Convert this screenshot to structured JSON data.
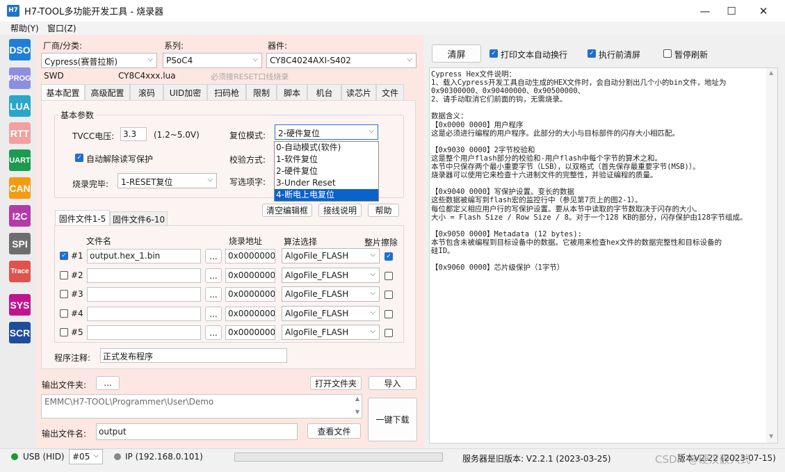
{
  "window": {
    "app_icon": "H7",
    "title": "H7-TOOL多功能开发工具 - 烧录器",
    "minimize": "—",
    "maximize": "☐",
    "close": "✕"
  },
  "menu": {
    "help": "帮助(Y)",
    "window": "窗口(Z)"
  },
  "sidebar": [
    {
      "label": "DSO",
      "color": "#1f7fd8"
    },
    {
      "label": "PROG",
      "color": "#8c8ee0"
    },
    {
      "label": "LUA",
      "color": "#2aa6c9"
    },
    {
      "label": "RTT",
      "color": "#f2a0a0"
    },
    {
      "label": "UART",
      "color": "#1a9b4e"
    },
    {
      "label": "CAN",
      "color": "#f39c12"
    },
    {
      "label": "I2C",
      "color": "#b33aa8"
    },
    {
      "label": "SPI",
      "color": "#6e6e6e"
    },
    {
      "label": "Trace",
      "color": "#e0534c"
    },
    {
      "label": "SYS",
      "color": "#c0148f"
    },
    {
      "label": "SCR",
      "color": "#1d4d9c"
    }
  ],
  "top": {
    "vendor_label": "厂商/分类:",
    "vendor_value": "Cypress(赛普拉斯)",
    "series_label": "系列:",
    "series_value": "PSoC4",
    "device_label": "器件:",
    "device_value": "CY8C4024AXI-S402",
    "interface": "SWD",
    "lua_file": "CY8C4xxx.lua",
    "reset_note": "必须接RESET口线烧录"
  },
  "tabs": [
    "基本配置",
    "高级配置",
    "滚码",
    "UID加密",
    "扫码枪",
    "限制",
    "脚本",
    "机台",
    "读芯片",
    "文件"
  ],
  "basic": {
    "group_title": "基本参数",
    "tvcc_label": "TVCC电压:",
    "tvcc_value": "3.3",
    "tvcc_range": "(1.2~5.0V)",
    "reset_label": "复位模式:",
    "reset_value": "2-硬件复位",
    "auto_unlock_label": "自动解除读写保护",
    "verify_label": "校验方式:",
    "after_label": "烧录完毕:",
    "after_value": "1-RESET复位",
    "option_label": "写选项字:",
    "reset_options": [
      "0-自动模式(软件)",
      "1-软件复位",
      "2-硬件复位",
      "3-Under Reset",
      "4-断电上电复位"
    ],
    "clear_btn": "清空编辑框",
    "wiring_btn": "接线说明",
    "help_btn": "帮助"
  },
  "files": {
    "subtabs": [
      "固件文件1-5",
      "固件文件6-10"
    ],
    "col_name": "文件名",
    "col_addr": "烧录地址",
    "col_algo": "算法选择",
    "col_erase": "整片擦除",
    "browse": "...",
    "rows": [
      {
        "idx": "#1",
        "checked": true,
        "name": "output.hex_1.bin",
        "addr": "0x00000000",
        "algo": "AlgoFile_FLASH",
        "erase": true
      },
      {
        "idx": "#2",
        "checked": false,
        "name": "",
        "addr": "0x00000000",
        "algo": "AlgoFile_FLASH",
        "erase": false
      },
      {
        "idx": "#3",
        "checked": false,
        "name": "",
        "addr": "0x00000000",
        "algo": "AlgoFile_FLASH",
        "erase": false
      },
      {
        "idx": "#4",
        "checked": false,
        "name": "",
        "addr": "0x00000000",
        "algo": "AlgoFile_FLASH",
        "erase": false
      },
      {
        "idx": "#5",
        "checked": false,
        "name": "",
        "addr": "0x00000000",
        "algo": "AlgoFile_FLASH",
        "erase": false
      }
    ],
    "note_label": "程序注释:",
    "note_value": "正式发布程序"
  },
  "output": {
    "folder_label": "输出文件夹:",
    "folder_btn": "...",
    "open_folder_btn": "打开文件夹",
    "import_btn": "导入",
    "path": "EMMC\\H7-TOOL\\Programmer\\User\\Demo",
    "one_click_btn": "一键下载",
    "filename_label": "输出文件名:",
    "filename_value": "output",
    "view_file_btn": "查看文件"
  },
  "right": {
    "clear_btn": "清屏",
    "print_wrap_label": "打印文本自动换行",
    "print_wrap_checked": true,
    "clear_before_label": "执行前清屏",
    "clear_before_checked": true,
    "pause_label": "暂停刷新",
    "pause_checked": false,
    "log_lines": [
      "Cypress Hex文件说明：",
      "1、载入Cypress开发工具自动生成的HEX文件时，会自动分割出几个小的bin文件，地址为",
      "0x90300000、0x90400000、0x90500000、",
      "2、请手动取消它们前面的钩，无需烧录。",
      "",
      "数据含义：",
      "【0x0000 0000】用户程序",
      "这是必须进行编程的用户程序。此部分的大小与目标部件的闪存大小相匹配。",
      "",
      "【0x9030 0000】2字节校验和",
      "这是整个用户flash部分的校验和-用户flash中每个字节的算术之和。",
      "本节中只保存两个最小重要字节（LSB），以双格式（首先保存最重要字节(MSB)）。",
      "烧录器可以使用它来检查十六进制文件的完整性，并验证编程的质量。",
      "",
      "【0x9040 0000】写保护设置。变长的数据",
      "这些数据被编写到flash宏的监控行中（参见第7页上的图2-1）。",
      "每位都定义相应用户行的写保护设置。要从本节中读取的字节数取决于闪存的大小。",
      "大小 = Flash Size / Row Size / 8。对于一个128 KB的部分，闪存保护由128字节组成。",
      "",
      "【0x9050 0000】Metadata (12 bytes):",
      "本节包含未被编程到目标设备中的数据。它被用来检查hex文件的数据完整性和目标设备的",
      "硅ID。",
      "",
      "【0x9060 0000】芯片级保护（1字节）"
    ]
  },
  "status": {
    "usb": "USB (HID)",
    "usb_color": "#1a9b2e",
    "device_no": "#05",
    "ip": "IP (192.168.0.101)",
    "ip_color": "#888888",
    "server": "服务器是旧版本: V2.2.1 (2023-03-25)",
    "version": "版本V2.22 (2023-07-15)",
    "watermark": "CSDN @硬汉嵌入式"
  }
}
